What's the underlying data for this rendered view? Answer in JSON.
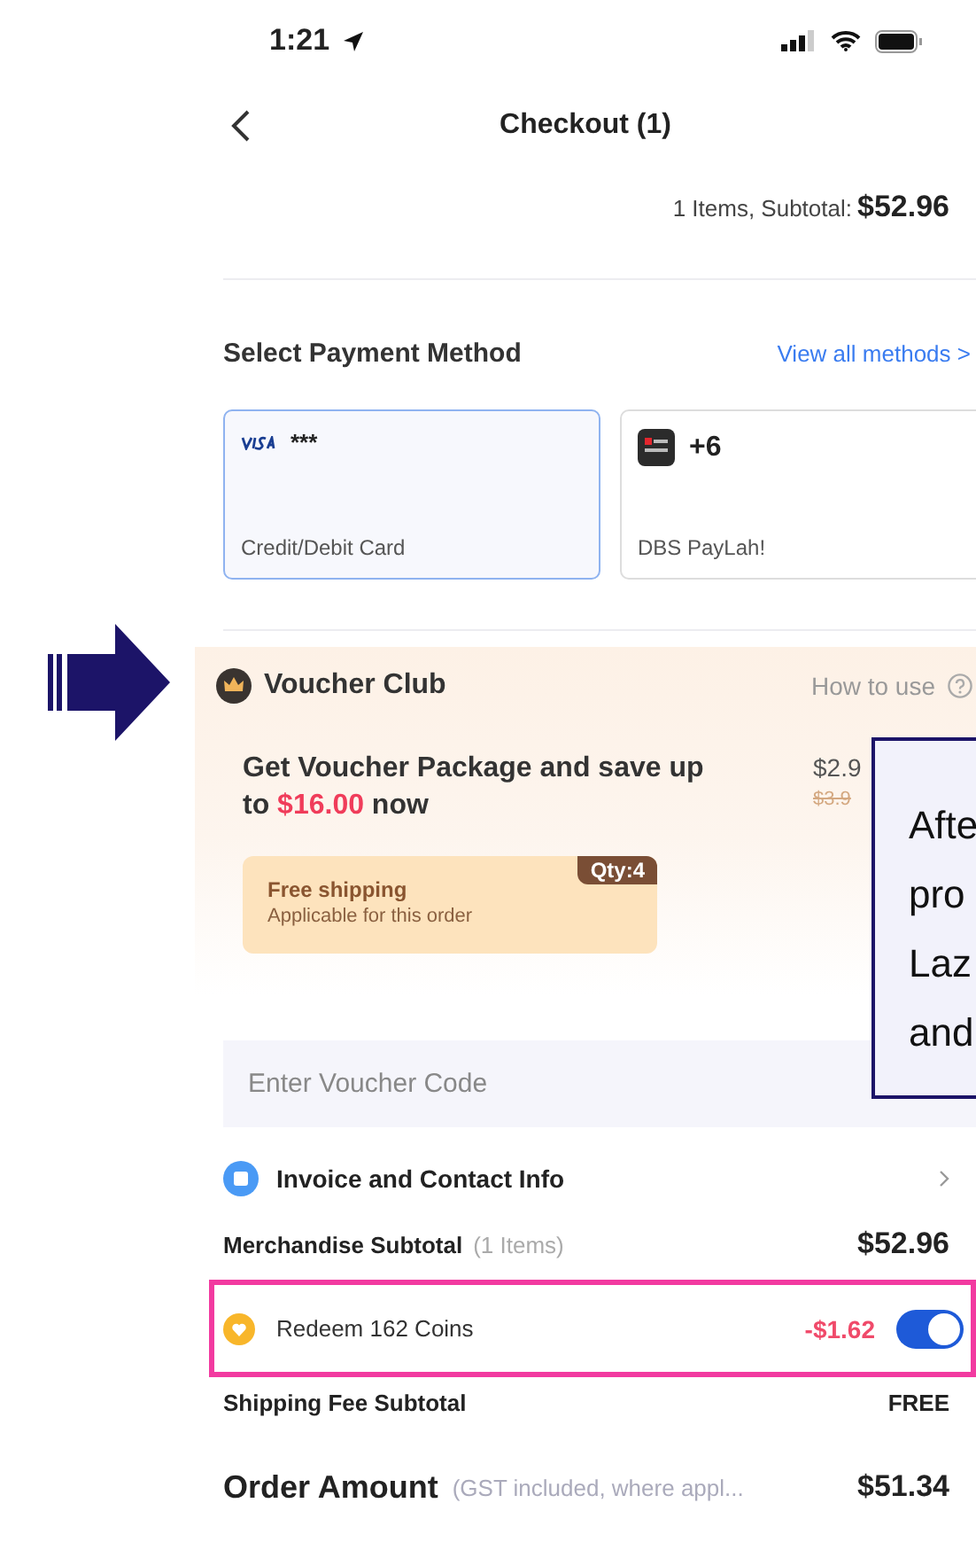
{
  "status_bar": {
    "time": "1:21"
  },
  "header": {
    "title": "Checkout (1)"
  },
  "summary": {
    "label": "1 Items, Subtotal:",
    "amount": "$52.96"
  },
  "payment": {
    "title": "Select Payment Method",
    "link": "View all methods >",
    "methods": [
      {
        "kind": "card",
        "number": "***",
        "label": "Credit/Debit Card",
        "selected": true
      },
      {
        "kind": "wallet",
        "number": "+6",
        "label": "DBS PayLah!",
        "selected": false
      }
    ]
  },
  "voucher_club": {
    "title": "Voucher Club",
    "help": "How to use",
    "offer": "Get Voucher Package and save up to **$16.00** now",
    "price": "$2.9",
    "old_price": "$3.9",
    "coupon": {
      "title": "Free shipping",
      "subtitle": "Applicable for this order",
      "qty": "Qty:4"
    }
  },
  "voucher_code": {
    "placeholder": "Enter Voucher Code"
  },
  "invoice": {
    "label": "Invoice and Contact Info"
  },
  "rows": [
    {
      "kind": "subtotal",
      "label": "Merchandise Subtotal",
      "note": "(1 Items)",
      "value": "$52.96",
      "highlighted": false
    },
    {
      "kind": "coins",
      "label": "Redeem 162 Coins",
      "value": "-$1.62",
      "on": true,
      "highlighted": true
    },
    {
      "kind": "shipping",
      "label": "Shipping Fee Subtotal",
      "value": "FREE",
      "highlighted": false
    },
    {
      "kind": "total",
      "label": "Order Amount",
      "note": "(GST included, where appl...",
      "value": "$51.34",
      "highlighted": false
    }
  ],
  "callout": {
    "lines": [
      "Afte",
      "pro",
      "Laz",
      "and"
    ]
  }
}
